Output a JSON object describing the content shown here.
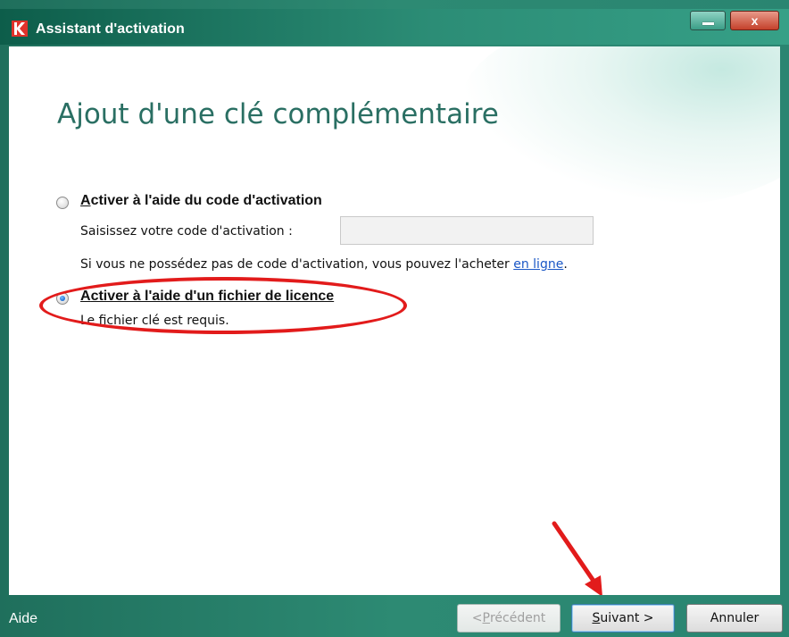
{
  "window": {
    "title": "Assistant d'activation",
    "controls": {
      "minimize_icon": "minimize-icon",
      "close_icon": "close-icon",
      "close_glyph": "x"
    }
  },
  "heading": "Ajout d'une clé complémentaire",
  "options": [
    {
      "label_accel": "A",
      "label_rest": "ctiver à l'aide du code d'activation",
      "selected": false,
      "code_prompt": "Saisissez votre code d'activation :",
      "code_value": "",
      "purchase_text": "Si vous ne possédez pas de code d'activation, vous pouvez l'acheter ",
      "purchase_link": "en ligne",
      "purchase_end": "."
    },
    {
      "label_accel": "A",
      "label_rest": "ctiver à l'aide d'un fichier de licence",
      "selected": true,
      "description": "Le fichier clé est requis."
    }
  ],
  "annotations": {
    "highlight_color": "#e21b1b",
    "arrow_color": "#e21b1b"
  },
  "footer": {
    "help_label": "Aide",
    "prev_pre": "< ",
    "prev_accel": "P",
    "prev_rest": "récédent",
    "next_accel": "S",
    "next_rest": "uivant >",
    "cancel_label": "Annuler"
  }
}
